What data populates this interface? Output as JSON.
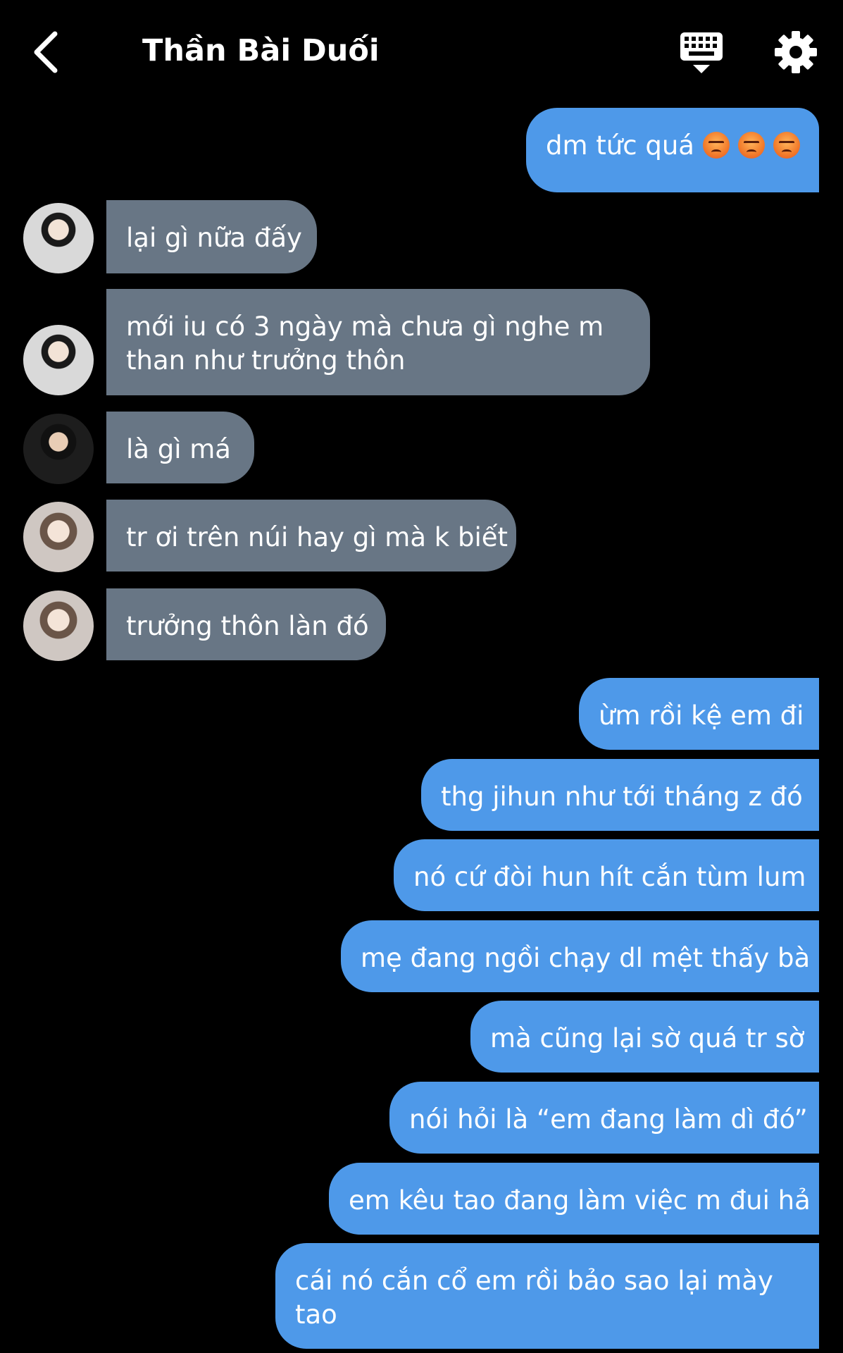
{
  "header": {
    "title": "Thần Bài Duối",
    "back_icon": "chevron-left-icon",
    "keyboard_icon": "keyboard-icon",
    "settings_icon": "gear-icon"
  },
  "colors": {
    "background": "#000000",
    "incoming_bubble": "#687685",
    "outgoing_bubble": "#4e99e9",
    "text": "#ffffff"
  },
  "messages": [
    {
      "side": "out",
      "text": "dm tức quá",
      "emoji": [
        "angry-face-icon",
        "angry-face-icon",
        "angry-face-icon"
      ]
    },
    {
      "side": "in",
      "text": "lại gì nữa đấy"
    },
    {
      "side": "in",
      "lines": [
        "mới iu có 3 ngày mà chưa gì nghe m",
        "than như trưởng thôn"
      ]
    },
    {
      "side": "in",
      "text": "là gì má"
    },
    {
      "side": "in",
      "text": "tr ơi trên núi hay gì mà k biết"
    },
    {
      "side": "in",
      "text": "trưởng thôn làn đó"
    },
    {
      "side": "out",
      "text": "ừm rồi kệ em đi"
    },
    {
      "side": "out",
      "text": "thg jihun như tới tháng z đó"
    },
    {
      "side": "out",
      "text": "nó cứ đòi hun hít cắn tùm lum"
    },
    {
      "side": "out",
      "text": "mẹ đang ngồi chạy dl mệt thấy bà"
    },
    {
      "side": "out",
      "text": "mà cũng lại sờ quá tr sờ"
    },
    {
      "side": "out",
      "text": "nói hỏi là “em đang làm dì đó”"
    },
    {
      "side": "out",
      "text": "em kêu tao đang làm việc m đui hả"
    },
    {
      "side": "out",
      "lines": [
        "cái nó cắn cổ em rồi bảo sao lại mày",
        "tao"
      ]
    }
  ]
}
